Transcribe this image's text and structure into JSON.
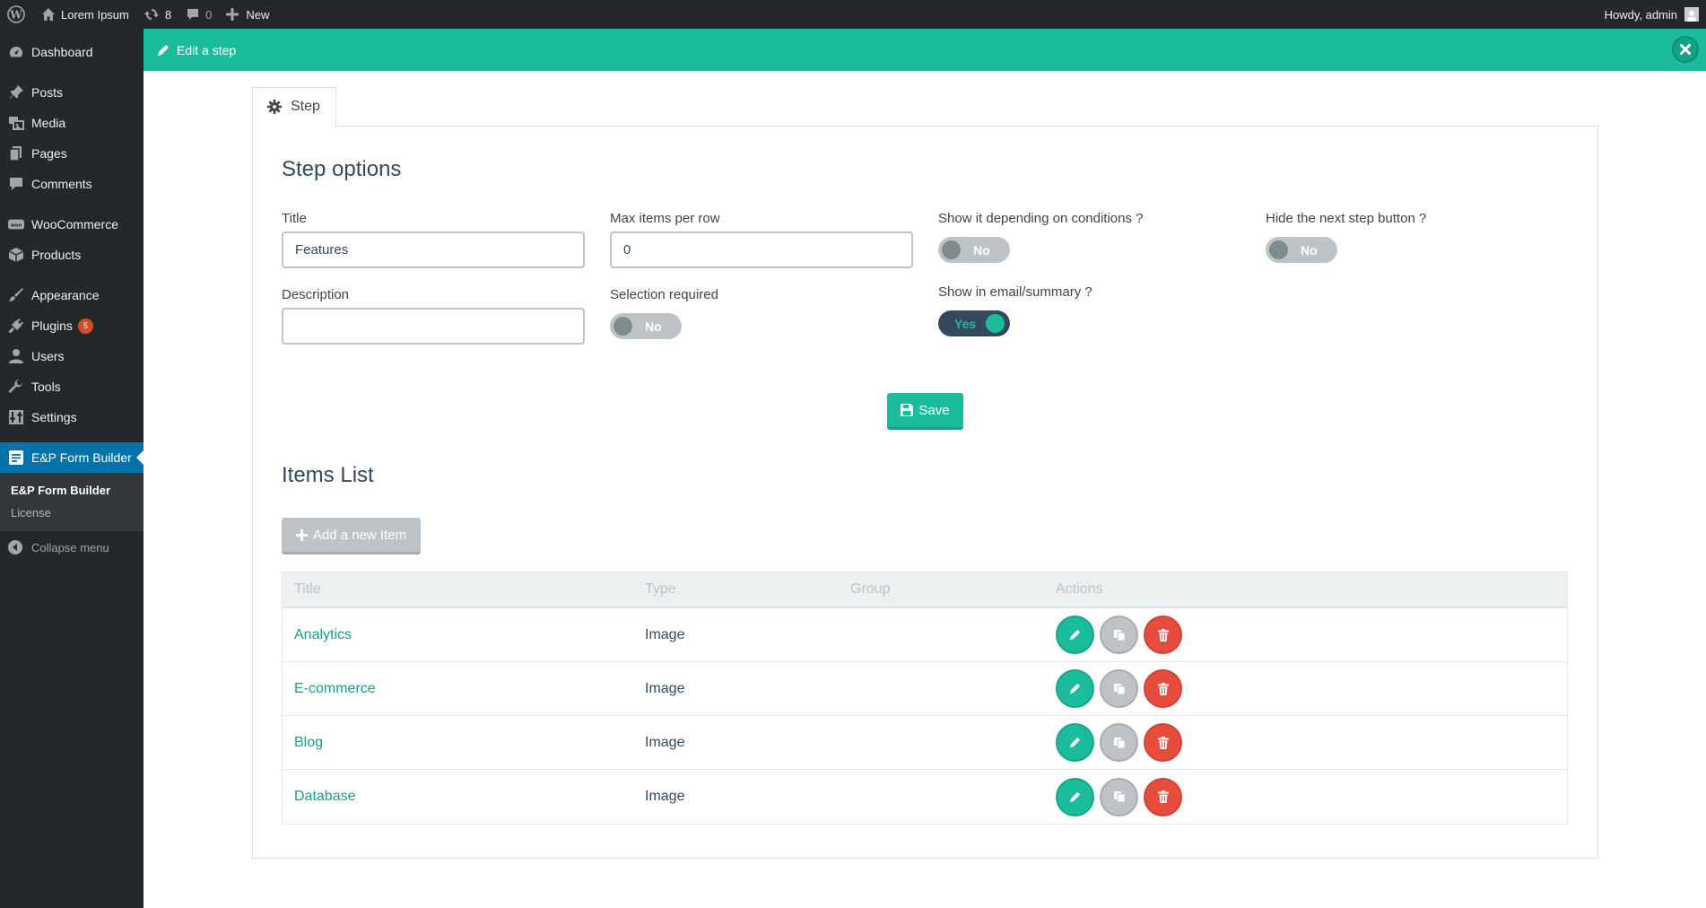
{
  "adminbar": {
    "site_name": "Lorem Ipsum",
    "updates_count": "8",
    "comments_count": "0",
    "new_label": "New",
    "howdy": "Howdy, admin"
  },
  "sidebar": {
    "items": [
      {
        "label": "Dashboard",
        "icon": "dashboard-icon"
      },
      {
        "label": "Posts",
        "icon": "pin-icon"
      },
      {
        "label": "Media",
        "icon": "media-icon"
      },
      {
        "label": "Pages",
        "icon": "pages-icon"
      },
      {
        "label": "Comments",
        "icon": "comment-icon"
      },
      {
        "label": "WooCommerce",
        "icon": "woo-icon"
      },
      {
        "label": "Products",
        "icon": "box-icon"
      },
      {
        "label": "Appearance",
        "icon": "brush-icon"
      },
      {
        "label": "Plugins",
        "icon": "plug-icon",
        "badge": "5"
      },
      {
        "label": "Users",
        "icon": "user-icon"
      },
      {
        "label": "Tools",
        "icon": "wrench-icon"
      },
      {
        "label": "Settings",
        "icon": "settings-icon"
      },
      {
        "label": "E&P Form Builder",
        "icon": "form-icon"
      }
    ],
    "submenu": [
      "E&P Form Builder",
      "License"
    ],
    "collapse_label": "Collapse menu"
  },
  "editbar": {
    "title": "Edit a step"
  },
  "tab": {
    "label": "Step"
  },
  "step_options": {
    "heading": "Step options",
    "title_label": "Title",
    "title_value": "Features",
    "description_label": "Description",
    "description_value": "",
    "max_items_label": "Max items per row",
    "max_items_value": "0",
    "selection_required_label": "Selection required",
    "selection_required_value": "No",
    "show_conditions_label": "Show it depending on conditions ?",
    "show_conditions_value": "No",
    "show_email_label": "Show in email/summary ?",
    "show_email_value": "Yes",
    "hide_next_label": "Hide the next step button ?",
    "hide_next_value": "No",
    "save_label": "Save"
  },
  "items_list": {
    "heading": "Items List",
    "add_label": "Add a new Item",
    "columns": [
      "Title",
      "Type",
      "Group",
      "Actions"
    ],
    "rows": [
      {
        "title": "Analytics",
        "type": "Image",
        "group": ""
      },
      {
        "title": "E-commerce",
        "type": "Image",
        "group": ""
      },
      {
        "title": "Blog",
        "type": "Image",
        "group": ""
      },
      {
        "title": "Database",
        "type": "Image",
        "group": ""
      }
    ]
  },
  "colors": {
    "accent": "#1abc9c",
    "wp_dark": "#23282d",
    "wp_blue": "#0073aa",
    "danger": "#e74c3c"
  }
}
